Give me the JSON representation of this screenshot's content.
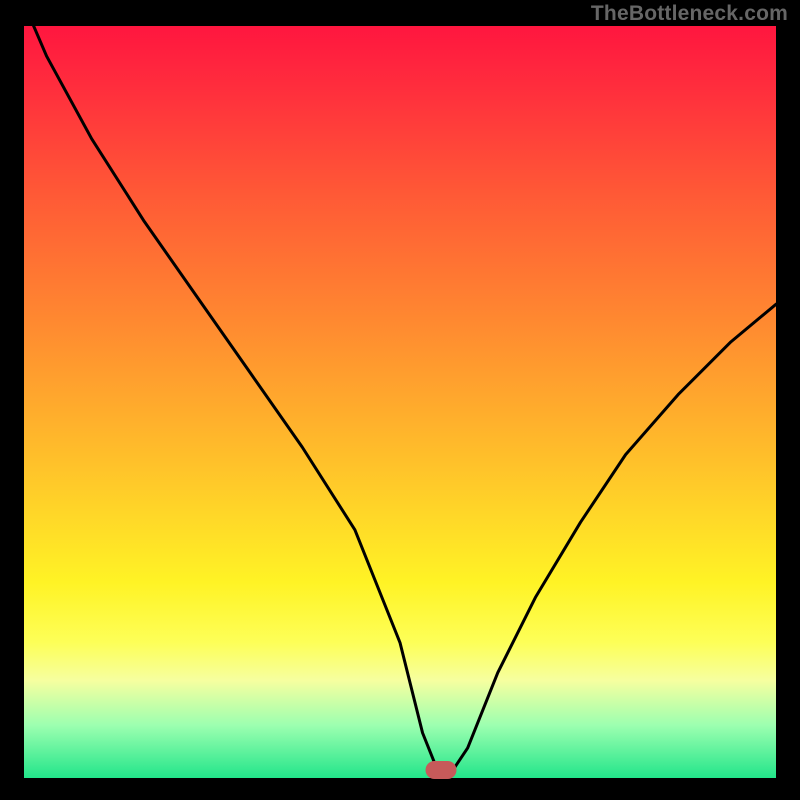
{
  "watermark": {
    "text": "TheBottleneck.com"
  },
  "plot": {
    "background_black": "#000000",
    "gradient_stops": [
      {
        "pos": 0,
        "color": "#ff163f"
      },
      {
        "pos": 8,
        "color": "#ff2d3d"
      },
      {
        "pos": 22,
        "color": "#ff5836"
      },
      {
        "pos": 40,
        "color": "#ff8b30"
      },
      {
        "pos": 58,
        "color": "#ffc12a"
      },
      {
        "pos": 74,
        "color": "#fff325"
      },
      {
        "pos": 82,
        "color": "#fdff58"
      },
      {
        "pos": 87,
        "color": "#f6ff9f"
      },
      {
        "pos": 93,
        "color": "#9cffb0"
      },
      {
        "pos": 100,
        "color": "#22e58a"
      }
    ],
    "marker": {
      "x_pct": 55.5,
      "y_pct": 98.9,
      "color": "#c75a5a"
    }
  },
  "chart_data": {
    "type": "line",
    "title": "",
    "xlabel": "",
    "ylabel": "",
    "xlim": [
      0,
      100
    ],
    "ylim": [
      0,
      100
    ],
    "note": "x is horizontal position (% of plot width, left→right); y is bottleneck percentage (0=green baseline, 100=top). Curve is V-shaped with minimum near x≈55.",
    "series": [
      {
        "name": "bottleneck-curve",
        "x": [
          0,
          3,
          9,
          16,
          23,
          30,
          37,
          44,
          50,
          53,
          55,
          57,
          59,
          63,
          68,
          74,
          80,
          87,
          94,
          100
        ],
        "y": [
          103,
          96,
          85,
          74,
          64,
          54,
          44,
          33,
          18,
          6,
          1,
          1,
          4,
          14,
          24,
          34,
          43,
          51,
          58,
          63
        ]
      }
    ],
    "annotations": [
      {
        "type": "marker",
        "x": 55.5,
        "y": 1,
        "label": "optimal-point"
      }
    ]
  }
}
